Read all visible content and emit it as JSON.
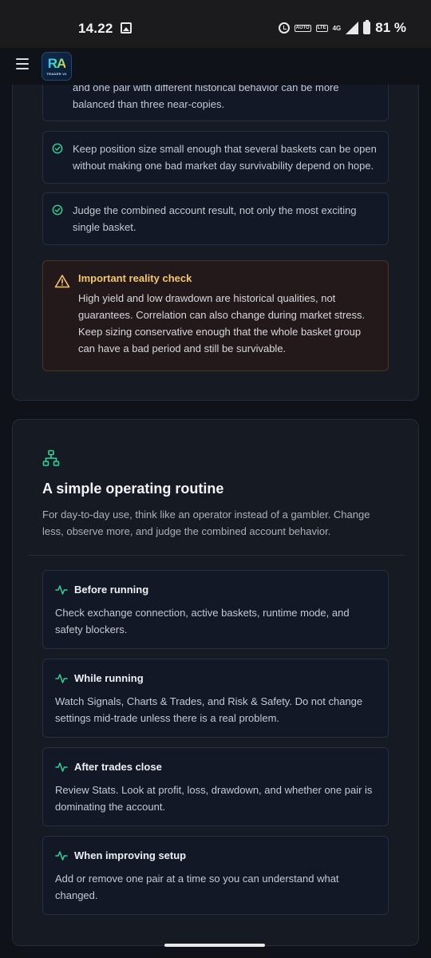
{
  "status_bar": {
    "time": "14.22",
    "auto_label": "AUTO",
    "volte_label": "LTE",
    "network": "4G",
    "battery": "81 %"
  },
  "app": {
    "logo_mark": "RA",
    "logo_sub": "TRADER V2"
  },
  "checklist": {
    "items": [
      "and one pair with different historical behavior can be more balanced than three near-copies.",
      "Keep position size small enough that several baskets can be open without making one bad market day survivability depend on hope.",
      "Judge the combined account result, not only the most exciting single basket."
    ]
  },
  "warning": {
    "title": "Important reality check",
    "body": "High yield and low drawdown are historical qualities, not guarantees. Correlation can also change during market stress. Keep sizing conservative enough that the whole basket group can have a bad period and still be survivable."
  },
  "routine": {
    "title": "A simple operating routine",
    "description": "For day-to-day use, think like an operator instead of a gambler. Change less, observe more, and judge the combined account behavior.",
    "steps": [
      {
        "title": "Before running",
        "body": "Check exchange connection, active baskets, runtime mode, and safety blockers."
      },
      {
        "title": "While running",
        "body": "Watch Signals, Charts & Trades, and Risk & Safety. Do not change settings mid-trade unless there is a real problem."
      },
      {
        "title": "After trades close",
        "body": "Review Stats. Look at profit, loss, drawdown, and whether one pair is dominating the account."
      },
      {
        "title": "When improving setup",
        "body": "Add or remove one pair at a time so you can understand what changed."
      }
    ]
  },
  "colors": {
    "accent_green": "#2fd39a",
    "warning_yellow": "#f4c76b",
    "background": "#0f1218",
    "card": "#161a23"
  },
  "icons": [
    "hamburger-menu-icon",
    "check-circle-icon",
    "warning-triangle-icon",
    "sitemap-icon",
    "activity-pulse-icon"
  ]
}
